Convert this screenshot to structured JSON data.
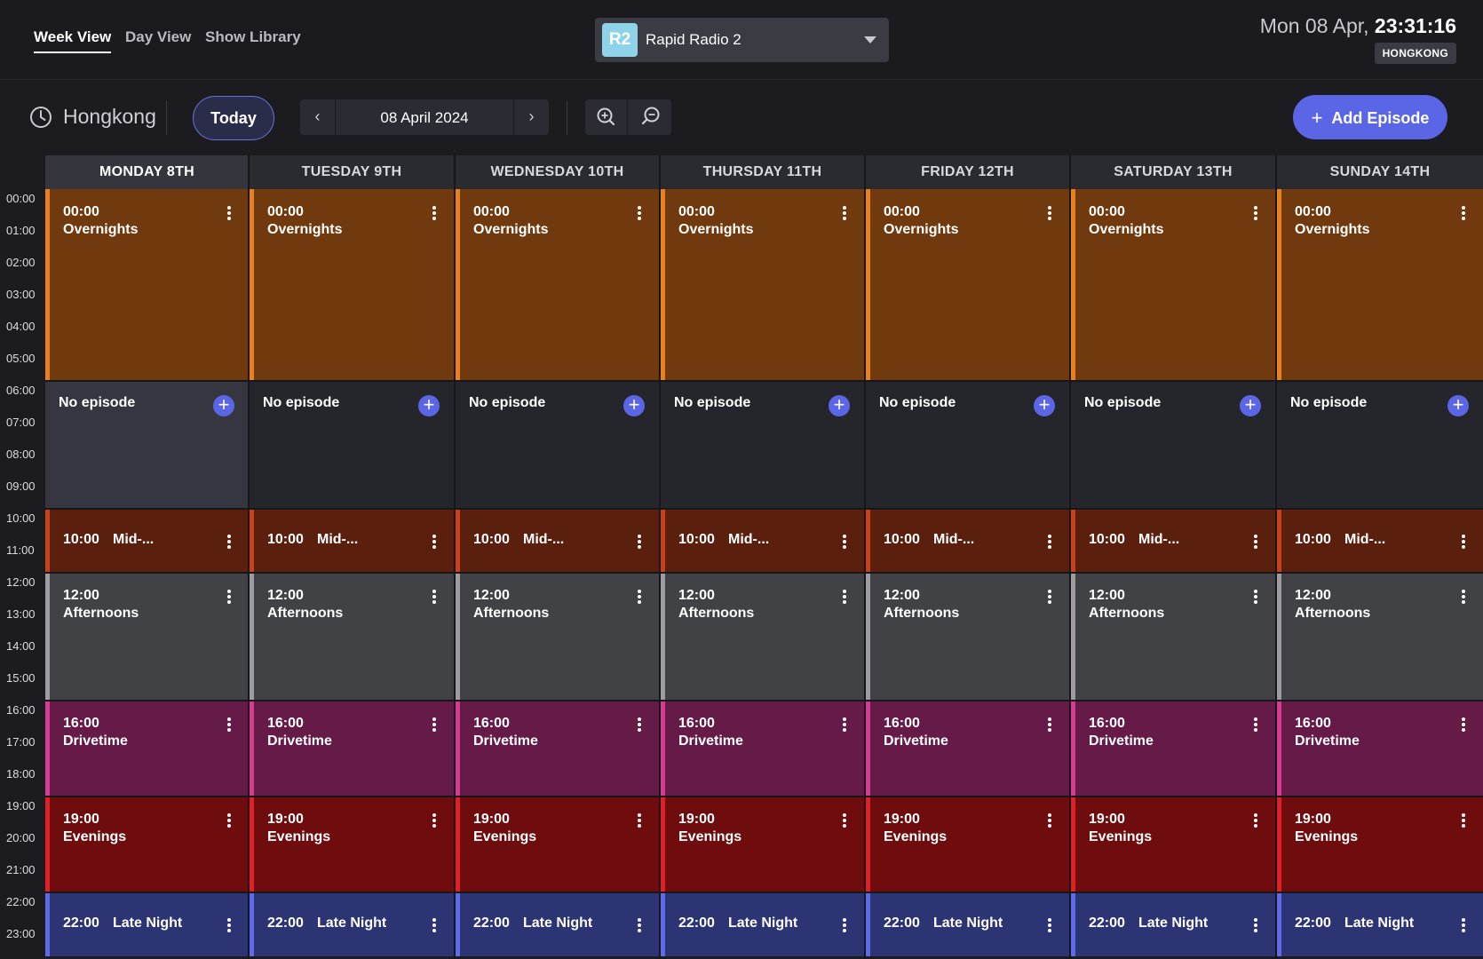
{
  "nav": {
    "tabs": [
      {
        "label": "Week View",
        "active": true
      },
      {
        "label": "Day View",
        "active": false
      },
      {
        "label": "Show Library",
        "active": false
      }
    ]
  },
  "station": {
    "logo": "R2",
    "name": "Rapid Radio 2",
    "logo_color": "#8fd3e8"
  },
  "clock": {
    "date": "Mon 08 Apr,",
    "time": "23:31:16",
    "timezone_badge": "HONGKONG"
  },
  "toolbar": {
    "timezone_label": "Hongkong",
    "today_label": "Today",
    "current_date": "08 April 2024",
    "prev_icon": "chevron-left-icon",
    "next_icon": "chevron-right-icon",
    "zoom_in_icon": "zoom-in-icon",
    "zoom_out_icon": "zoom-out-icon",
    "add_episode_label": "Add Episode"
  },
  "times": [
    "00:00",
    "01:00",
    "02:00",
    "03:00",
    "04:00",
    "05:00",
    "06:00",
    "07:00",
    "08:00",
    "09:00",
    "10:00",
    "11:00",
    "12:00",
    "13:00",
    "14:00",
    "15:00",
    "16:00",
    "17:00",
    "18:00",
    "19:00",
    "20:00",
    "21:00",
    "22:00",
    "23:00"
  ],
  "days": [
    {
      "label": "MONDAY 8TH",
      "current": true
    },
    {
      "label": "TUESDAY 9TH",
      "current": false
    },
    {
      "label": "WEDNESDAY 10TH",
      "current": false
    },
    {
      "label": "THURSDAY 11TH",
      "current": false
    },
    {
      "label": "FRIDAY 12TH",
      "current": false
    },
    {
      "label": "SATURDAY 13TH",
      "current": false
    },
    {
      "label": "SUNDAY 14TH",
      "current": false
    }
  ],
  "schedule": [
    {
      "type": "episode",
      "start": 0,
      "end": 6,
      "time": "00:00",
      "title": "Overnights",
      "style": "overnight",
      "color": "#e8801e"
    },
    {
      "type": "empty",
      "start": 6,
      "end": 10,
      "label": "No episode"
    },
    {
      "type": "episode",
      "start": 10,
      "end": 12,
      "time": "10:00",
      "title": "Mid-...",
      "style": "mid",
      "inline": true,
      "color": "#c9411a"
    },
    {
      "type": "episode",
      "start": 12,
      "end": 16,
      "time": "12:00",
      "title": "Afternoons",
      "style": "after",
      "color": "#9c9ca2"
    },
    {
      "type": "episode",
      "start": 16,
      "end": 19,
      "time": "16:00",
      "title": "Drivetime",
      "style": "drive",
      "color": "#d63b93"
    },
    {
      "type": "episode",
      "start": 19,
      "end": 22,
      "time": "19:00",
      "title": "Evenings",
      "style": "even",
      "color": "#e02025"
    },
    {
      "type": "episode",
      "start": 22,
      "end": 24,
      "time": "22:00",
      "title": "Late Night",
      "style": "late",
      "inline": true,
      "color": "#5c6bea"
    }
  ],
  "colors": {
    "accent": "#5a66e6",
    "background": "#1c1c20"
  }
}
